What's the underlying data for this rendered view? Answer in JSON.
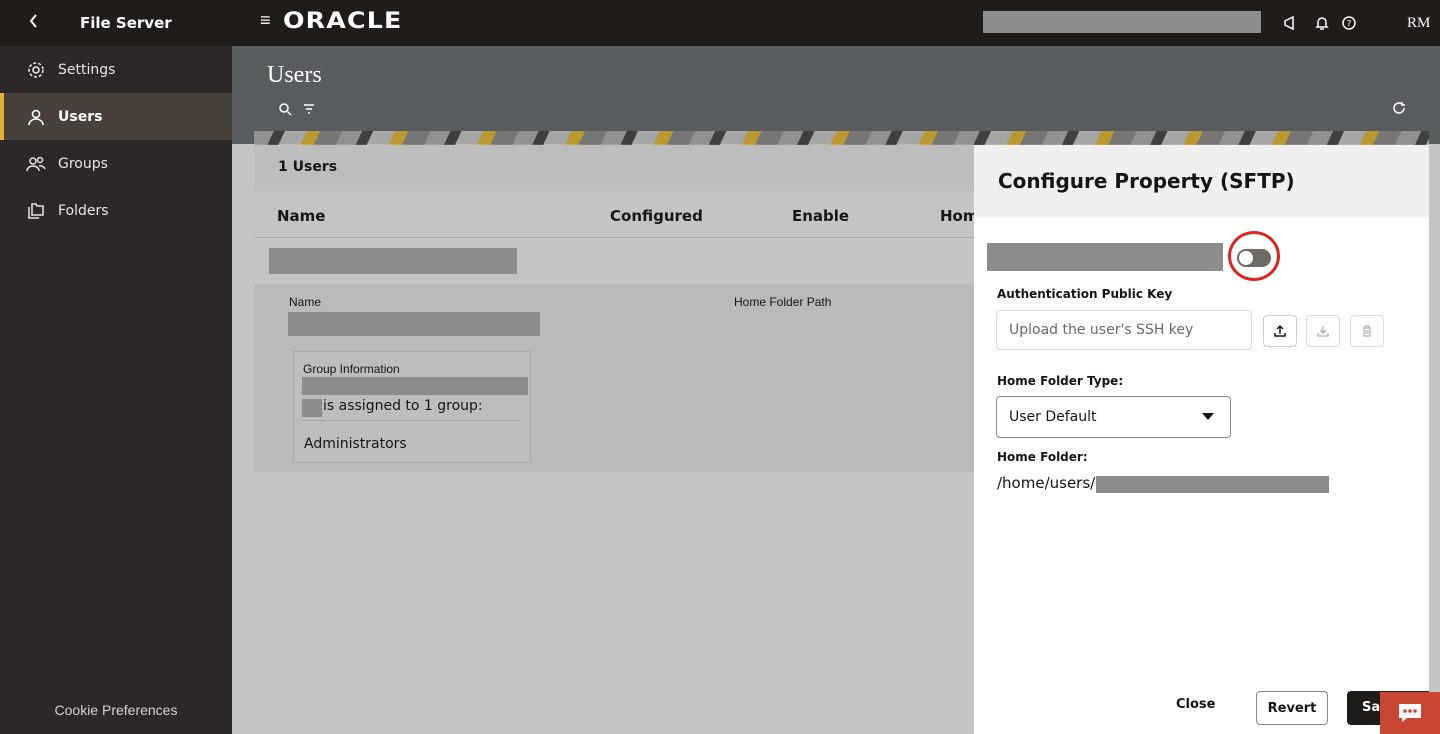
{
  "topbar": {
    "app_title": "File Server",
    "logo": "ORACLE",
    "user_initials": "RM",
    "icons": [
      "back-icon",
      "hamburger-icon",
      "megaphone-icon",
      "bell-icon",
      "help-icon"
    ]
  },
  "sidebar": {
    "items": [
      {
        "label": "Settings",
        "icon": "gear-icon"
      },
      {
        "label": "Users",
        "icon": "user-icon",
        "active": true
      },
      {
        "label": "Groups",
        "icon": "group-icon"
      },
      {
        "label": "Folders",
        "icon": "folders-icon"
      }
    ],
    "cookie_label": "Cookie Preferences"
  },
  "main": {
    "page_title": "Users",
    "count_label": "1 Users",
    "columns": [
      "Name",
      "Configured",
      "Enable",
      "Hom"
    ],
    "detail": {
      "name_label": "Name",
      "home_folder_path_label": "Home Folder Path",
      "group_info_label": "Group Information",
      "assigned_text": "is assigned to 1 group:",
      "group_name": "Administrators"
    }
  },
  "panel": {
    "title": "Configure Property (SFTP)",
    "toggle_on": false,
    "auth_key_label": "Authentication Public Key",
    "auth_key_placeholder": "Upload the user's SSH key",
    "home_folder_type_label": "Home Folder Type:",
    "home_folder_type_value": "User Default",
    "home_folder_label": "Home Folder:",
    "home_folder_prefix": "/home/users/",
    "buttons": {
      "close": "Close",
      "revert": "Revert",
      "save": "Sa"
    }
  },
  "colors": {
    "topbar": "#201c19",
    "sidebar": "#2b2827",
    "active_accent": "#e3b23c",
    "highlight_ring": "#d9261c",
    "chat": "#c74634"
  }
}
